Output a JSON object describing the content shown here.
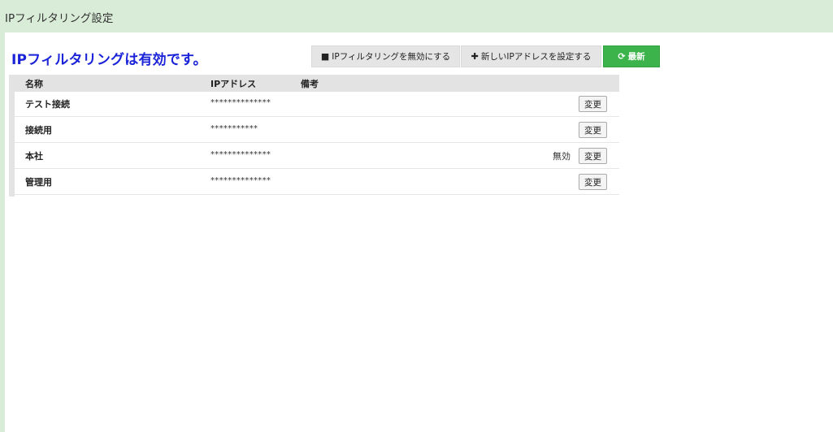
{
  "header": {
    "title": "IPフィルタリング設定"
  },
  "status": {
    "message": "IPフィルタリングは有効です。"
  },
  "toolbar": {
    "disable_label": "IPフィルタリングを無効にする",
    "disable_icon": "stop-square-icon",
    "add_label": "新しいIPアドレスを設定する",
    "add_icon": "plus-icon",
    "refresh_label": "最新",
    "refresh_icon": "refresh-icon"
  },
  "table": {
    "columns": {
      "name": "名称",
      "ip": "IPアドレス",
      "note": "備考"
    },
    "rows": [
      {
        "name": "テスト接続",
        "ip": "**************",
        "status": "",
        "edit_label": "変更"
      },
      {
        "name": "接続用",
        "ip": "***********",
        "status": "",
        "edit_label": "変更"
      },
      {
        "name": "本社",
        "ip": "**************",
        "status": "無効",
        "edit_label": "変更"
      },
      {
        "name": "管理用",
        "ip": "**************",
        "status": "",
        "edit_label": "変更"
      }
    ]
  },
  "colors": {
    "header_bg": "#d9ecd8",
    "status_text": "#1a23d8",
    "refresh_bg": "#3cb44b"
  }
}
